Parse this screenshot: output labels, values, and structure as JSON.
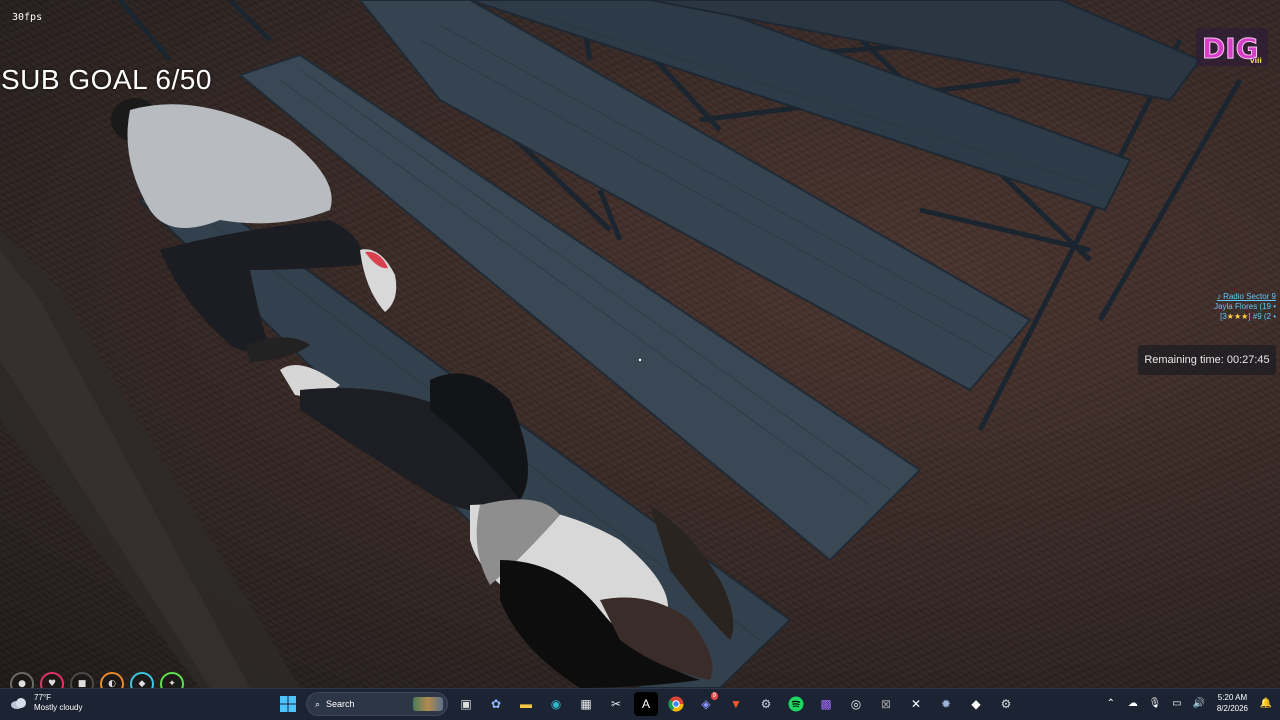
{
  "hud": {
    "fps": "30fps",
    "sub_goal": "SUB GOAL 6/50",
    "logo_text": "DIG",
    "logo_sub": "viii",
    "radio_station": "Radio Sector 9",
    "radio_line2": "Jayla Flores (19 •",
    "radio_line3_prefix": "[3",
    "radio_line3_stars": "★★★",
    "radio_line3_suffix": "] #9 (2 •",
    "remaining_time": "Remaining time: 00:27:45",
    "status_icons": [
      "drop-icon",
      "heart-icon",
      "armor-icon",
      "food-icon",
      "water-icon",
      "stamina-icon"
    ],
    "status_colors": [
      "#6b6b6b",
      "#e0336a",
      "#4a4a4a",
      "#e7892b",
      "#38c6e0",
      "#5de04d"
    ]
  },
  "taskbar": {
    "weather_temp": "77°F",
    "weather_desc": "Mostly cloudy",
    "search_label": "Search",
    "time": "5:20 AM",
    "date": "8/2/2026",
    "apps": [
      "task-view-icon",
      "copilot-icon",
      "file-explorer-icon",
      "edge-icon",
      "microsoft-store-icon",
      "snipping-icon",
      "capcut-icon",
      "chrome-icon",
      "discord-icon",
      "brave-icon",
      "steam-icon",
      "spotify-icon",
      "grid-app-icon",
      "obs-icon",
      "terminal-icon",
      "capcut2-icon",
      "settings-icon",
      "game-launcher-icon",
      "gear-app-icon"
    ],
    "discord_badge": "9"
  },
  "colors": {
    "taskbar_bg": "#1c2433",
    "radio_blue": "#5ec8ff",
    "star_yellow": "#ffd23f",
    "logo_magenta": "#d43fc6"
  }
}
